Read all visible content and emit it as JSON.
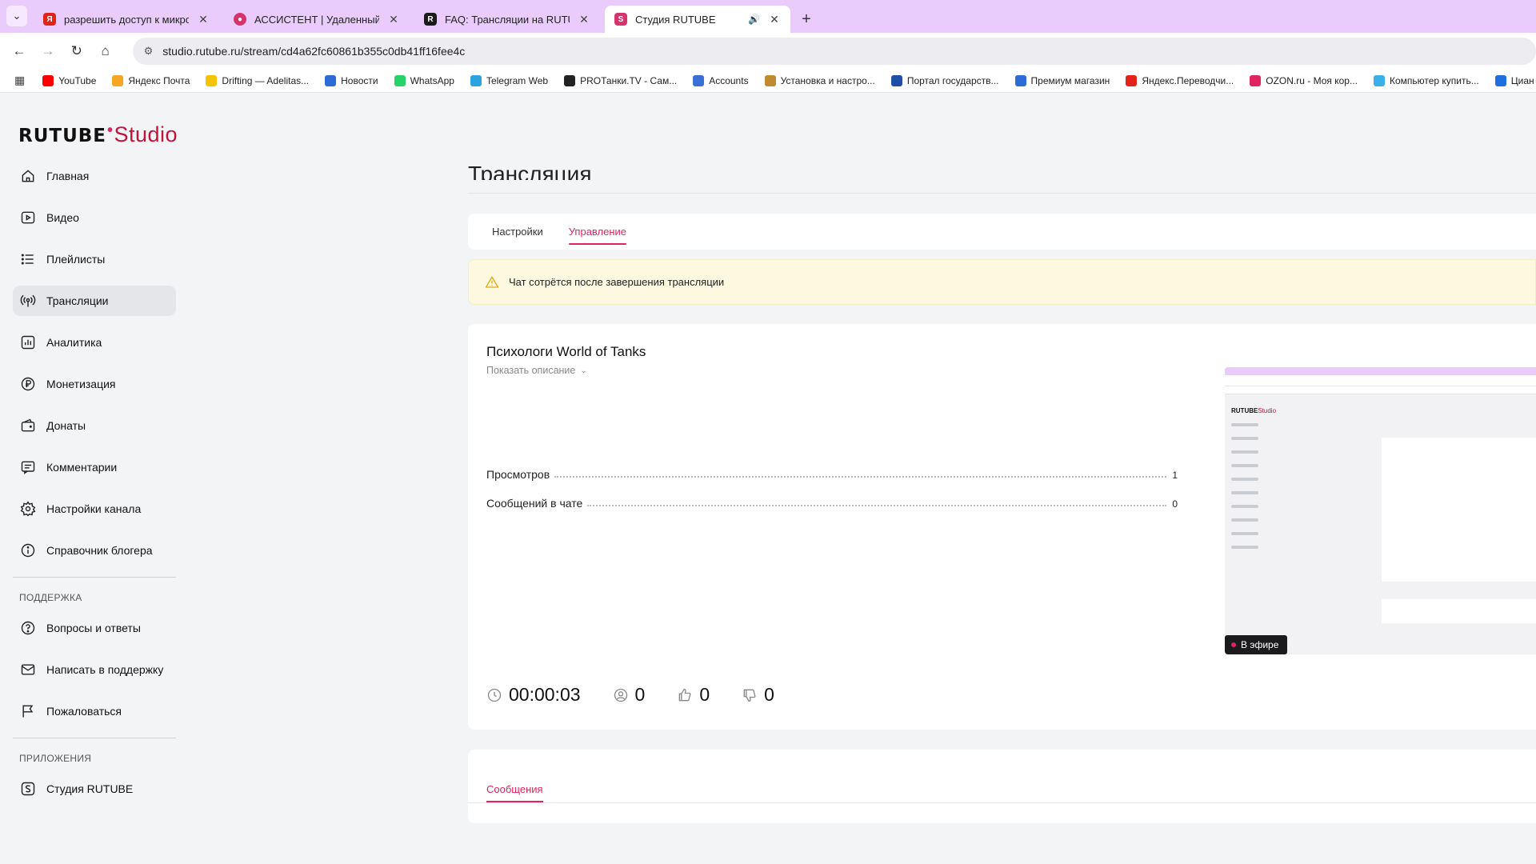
{
  "browser": {
    "tabs": [
      {
        "title": "разрешить доступ к микрофону",
        "favicon": "yandex-icon",
        "color": "#e2231a",
        "active": false
      },
      {
        "title": "АССИСТЕНТ | Удаленный доступ",
        "favicon": "assistant-icon",
        "color": "#d6336c",
        "active": false
      },
      {
        "title": "FAQ: Трансляции на RUTUBE",
        "favicon": "rutube-icon",
        "color": "#1b1b1d",
        "active": false
      },
      {
        "title": "Студия RUTUBE",
        "favicon": "rutube-studio-icon",
        "color": "#d6336c",
        "active": true
      }
    ],
    "url": "studio.rutube.ru/stream/cd4a62fc60861b355c0db41ff16fee4c",
    "bookmarks": [
      {
        "label": "YouTube",
        "icon": "youtube-icon",
        "color": "#ff0000"
      },
      {
        "label": "Яндекс Почта",
        "icon": "mail-icon",
        "color": "#f5a623"
      },
      {
        "label": "Drifting — Adelitas...",
        "icon": "sun-icon",
        "color": "#f5c400"
      },
      {
        "label": "Новости",
        "icon": "vk-icon",
        "color": "#2d6bd6"
      },
      {
        "label": "WhatsApp",
        "icon": "whatsapp-icon",
        "color": "#25d366"
      },
      {
        "label": "Telegram Web",
        "icon": "telegram-icon",
        "color": "#2aa3df"
      },
      {
        "label": "PROТанки.TV - Сам...",
        "icon": "protanki-icon",
        "color": "#222222"
      },
      {
        "label": "Accounts",
        "icon": "accounts-icon",
        "color": "#3a6fd8"
      },
      {
        "label": "Установка и настро...",
        "icon": "install-icon",
        "color": "#c08a2e"
      },
      {
        "label": "Портал государств...",
        "icon": "gosuslugi-icon",
        "color": "#1f4ea8"
      },
      {
        "label": "Премиум магазин",
        "icon": "premium-icon",
        "color": "#2d6bd6"
      },
      {
        "label": "Яндекс.Переводчи...",
        "icon": "translate-icon",
        "color": "#e2231a"
      },
      {
        "label": "OZON.ru - Моя кор...",
        "icon": "ozon-icon",
        "color": "#e0245e"
      },
      {
        "label": "Компьютер купить...",
        "icon": "computer-icon",
        "color": "#3ab0e8"
      },
      {
        "label": "Циан -",
        "icon": "cian-icon",
        "color": "#1f6fe0"
      }
    ]
  },
  "logo": {
    "brand": "RUTUBE",
    "product": "Studio"
  },
  "sidebar": {
    "items": [
      {
        "label": "Главная",
        "icon": "home-icon"
      },
      {
        "label": "Видео",
        "icon": "video-icon"
      },
      {
        "label": "Плейлисты",
        "icon": "playlist-icon"
      },
      {
        "label": "Трансляции",
        "icon": "broadcast-icon",
        "active": true
      },
      {
        "label": "Аналитика",
        "icon": "analytics-icon"
      },
      {
        "label": "Монетизация",
        "icon": "ruble-icon"
      },
      {
        "label": "Донаты",
        "icon": "wallet-icon"
      },
      {
        "label": "Комментарии",
        "icon": "comment-icon"
      },
      {
        "label": "Настройки канала",
        "icon": "gear-icon"
      },
      {
        "label": "Справочник блогера",
        "icon": "info-icon"
      }
    ],
    "support_title": "ПОДДЕРЖКА",
    "support_items": [
      {
        "label": "Вопросы и ответы",
        "icon": "question-icon"
      },
      {
        "label": "Написать в поддержку",
        "icon": "mail-icon"
      },
      {
        "label": "Пожаловаться",
        "icon": "flag-icon"
      }
    ],
    "apps_title": "ПРИЛОЖЕНИЯ",
    "apps_items": [
      {
        "label": "Студия RUTUBE",
        "icon": "studio-app-icon"
      }
    ]
  },
  "main": {
    "title": "Трансляция",
    "tabs": [
      {
        "label": "Настройки",
        "active": false
      },
      {
        "label": "Управление",
        "active": true
      }
    ],
    "alert": "Чат сотрётся после завершения трансляции",
    "stream": {
      "title": "Психологи World of Tanks",
      "show_description": "Показать описание",
      "stats": [
        {
          "label": "Просмотров",
          "value": "1"
        },
        {
          "label": "Сообщений в чате",
          "value": "0"
        }
      ],
      "live_badge": "В эфире",
      "duration": "00:00:03",
      "viewers": "0",
      "likes": "0",
      "dislikes": "0"
    },
    "messages_tab": "Сообщения"
  },
  "colors": {
    "accent": "#e0245e",
    "tabbar": "#e9ccfb",
    "alert_bg": "#fdf9e1"
  }
}
